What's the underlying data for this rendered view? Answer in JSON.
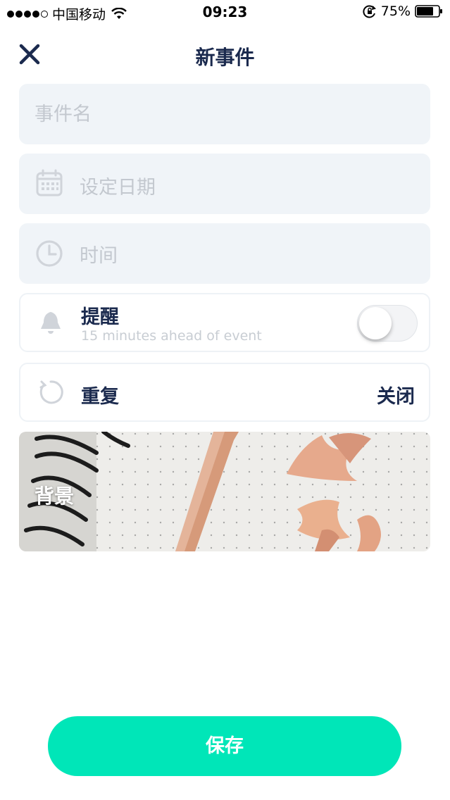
{
  "status_bar": {
    "carrier": "中国移动",
    "time": "09:23",
    "battery": "75%"
  },
  "header": {
    "title": "新事件"
  },
  "form": {
    "event_name_placeholder": "事件名",
    "date_label": "设定日期",
    "time_label": "时间",
    "reminder": {
      "label": "提醒",
      "sublabel": "15 minutes ahead of event",
      "enabled": false
    },
    "repeat": {
      "label": "重复",
      "value": "关闭"
    },
    "background_label": "背景"
  },
  "save_label": "保存",
  "colors": {
    "primary_text": "#1b2a4e",
    "field_bg": "#f0f4f8",
    "placeholder": "#c3c8cf",
    "save_button": "#00e6b8"
  },
  "icons": [
    "close-icon",
    "calendar-icon",
    "clock-icon",
    "bell-icon",
    "repeat-icon",
    "wifi-icon",
    "battery-icon"
  ]
}
